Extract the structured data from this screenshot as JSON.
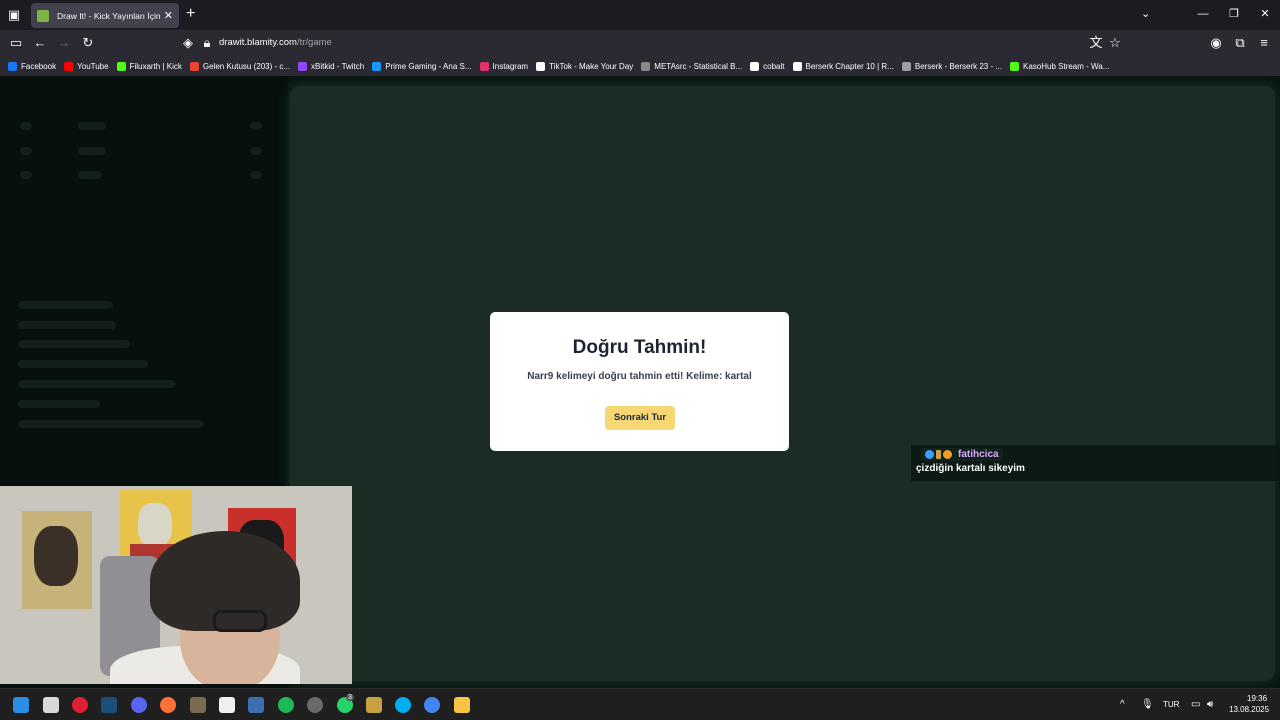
{
  "browser": {
    "tab": {
      "title": "Draw It! - Kick Yayınları İçin"
    },
    "url": {
      "host": "drawit.blamity.com",
      "path": "/tr/game"
    },
    "bookmarks": [
      {
        "label": "Facebook",
        "color": "#1877f2"
      },
      {
        "label": "YouTube",
        "color": "#ff0000"
      },
      {
        "label": "Filuxarth | Kick",
        "color": "#53fc18"
      },
      {
        "label": "Gelen Kutusu (203) - c...",
        "color": "#ea4335"
      },
      {
        "label": "xBitkid - Twitch",
        "color": "#9146ff"
      },
      {
        "label": "Prime Gaming - Ana S...",
        "color": "#1a98ff"
      },
      {
        "label": "Instagram",
        "color": "#e1306c"
      },
      {
        "label": "TikTok - Make Your Day",
        "color": "#ffffff"
      },
      {
        "label": "METAsrc - Statistical B...",
        "color": "#8a8a8a"
      },
      {
        "label": "cobalt",
        "color": "#ffffff"
      },
      {
        "label": "Berserk Chapter 10 | R...",
        "color": "#ffffff"
      },
      {
        "label": "Berserk - Berserk 23 - ...",
        "color": "#9aa0a6"
      },
      {
        "label": "KasoHub Stream - Wa...",
        "color": "#53fc18"
      }
    ]
  },
  "modal": {
    "title": "Doğru Tahmin!",
    "message": "Narr9 kelimeyi doğru tahmin etti! Kelime: kartal",
    "next_button": "Sonraki Tur"
  },
  "chat": {
    "username": "fatihcica",
    "message": "çizdiğin kartalı sikeyim"
  },
  "taskbar": {
    "language": "TUR",
    "time": "19:36",
    "date": "13.08.2025",
    "whatsapp_badge": "3"
  },
  "colors": {
    "accent": "#f7d774",
    "canvas_bg": "#1b2c25",
    "chat_name": "#d9a9ff"
  }
}
